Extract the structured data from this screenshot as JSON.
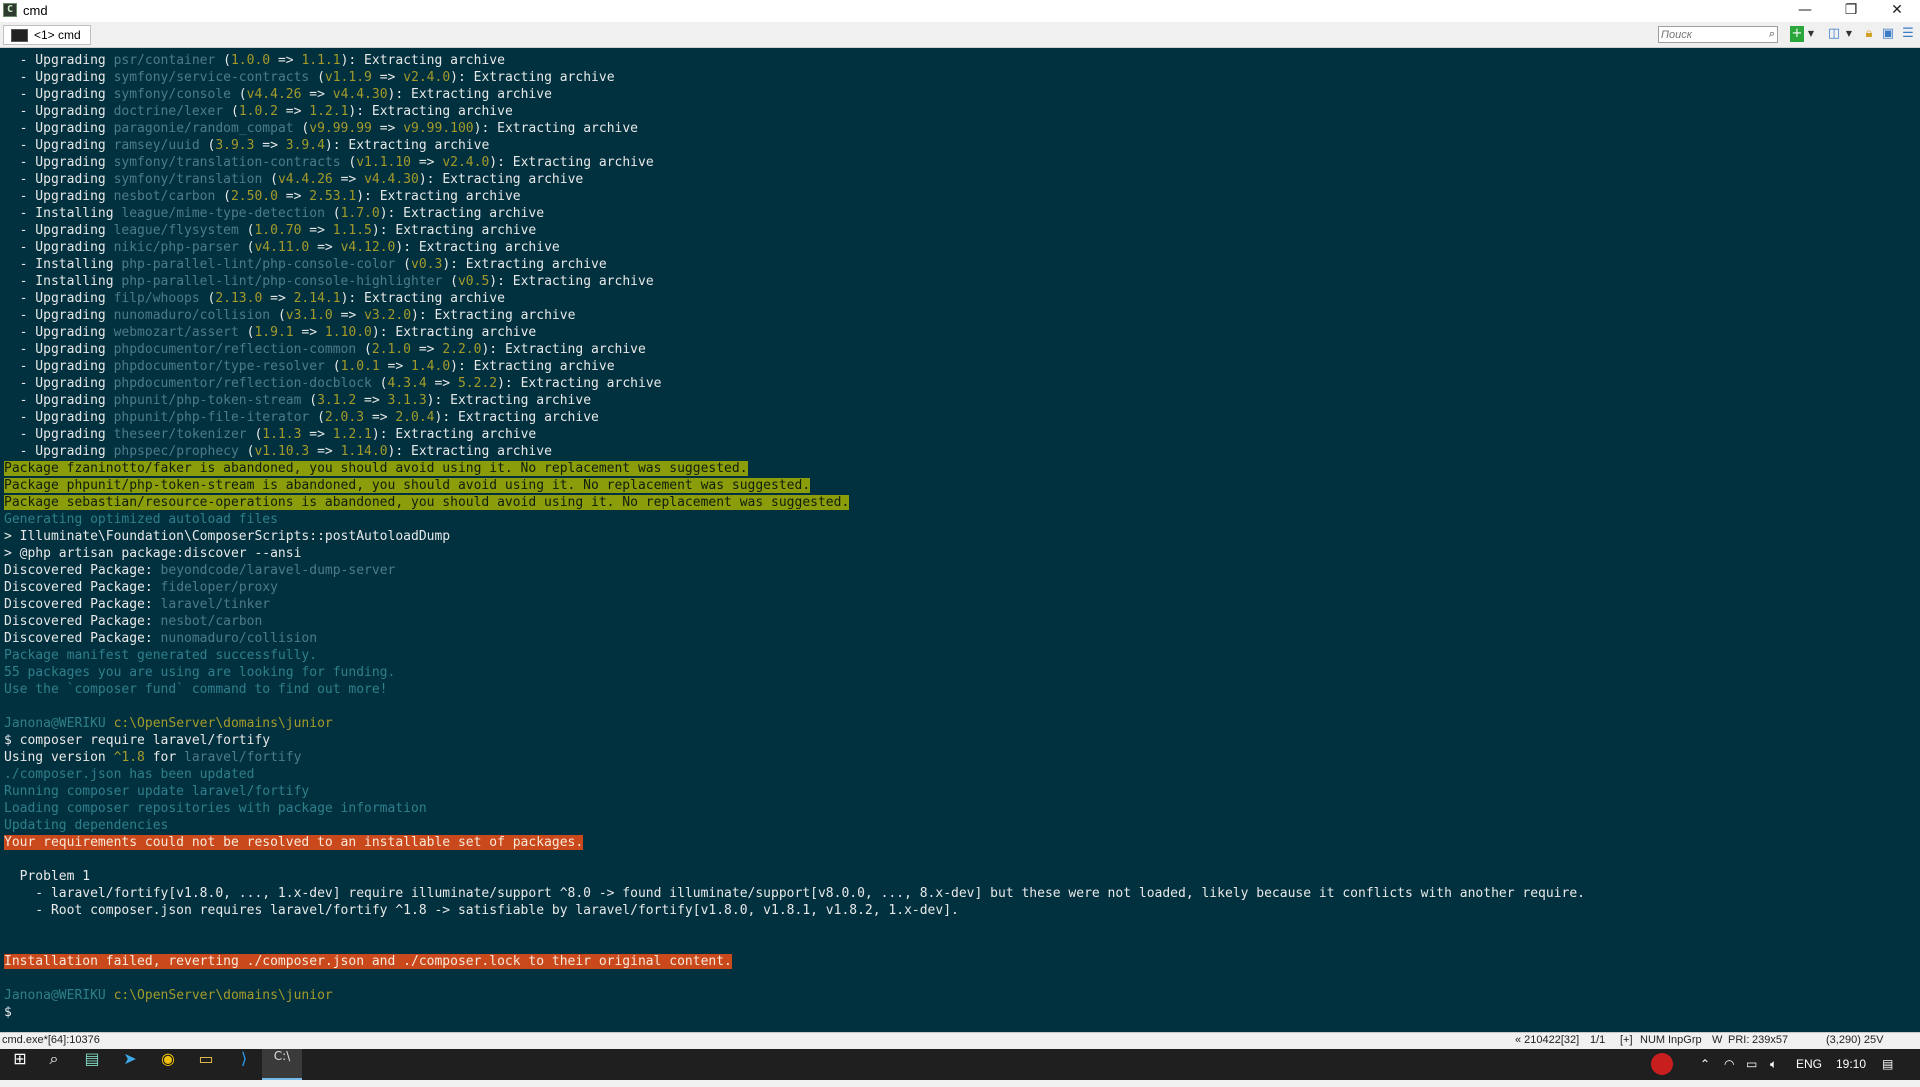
{
  "window": {
    "title": "cmd",
    "app_icon": "C",
    "minimize": "—",
    "restore": "❐",
    "close": "✕"
  },
  "tab": {
    "label": "<1> cmd"
  },
  "search": {
    "placeholder": "Поиск"
  },
  "toolbar_icons": [
    "add-console-icon",
    "dropdown-icon",
    "split-view-icon",
    "dropdown-icon",
    "lock-icon",
    "panel-icon",
    "menu-icon"
  ],
  "terminal": {
    "upgrades": [
      {
        "verb": "Upgrading",
        "pkg": "psr/container",
        "from": "1.0.0",
        "to": "1.1.1"
      },
      {
        "verb": "Upgrading",
        "pkg": "symfony/service-contracts",
        "from": "v1.1.9",
        "to": "v2.4.0"
      },
      {
        "verb": "Upgrading",
        "pkg": "symfony/console",
        "from": "v4.4.26",
        "to": "v4.4.30"
      },
      {
        "verb": "Upgrading",
        "pkg": "doctrine/lexer",
        "from": "1.0.2",
        "to": "1.2.1"
      },
      {
        "verb": "Upgrading",
        "pkg": "paragonie/random_compat",
        "from": "v9.99.99",
        "to": "v9.99.100"
      },
      {
        "verb": "Upgrading",
        "pkg": "ramsey/uuid",
        "from": "3.9.3",
        "to": "3.9.4"
      },
      {
        "verb": "Upgrading",
        "pkg": "symfony/translation-contracts",
        "from": "v1.1.10",
        "to": "v2.4.0"
      },
      {
        "verb": "Upgrading",
        "pkg": "symfony/translation",
        "from": "v4.4.26",
        "to": "v4.4.30"
      },
      {
        "verb": "Upgrading",
        "pkg": "nesbot/carbon",
        "from": "2.50.0",
        "to": "2.53.1"
      },
      {
        "verb": "Installing",
        "pkg": "league/mime-type-detection",
        "from": "",
        "to": "1.7.0"
      },
      {
        "verb": "Upgrading",
        "pkg": "league/flysystem",
        "from": "1.0.70",
        "to": "1.1.5"
      },
      {
        "verb": "Upgrading",
        "pkg": "nikic/php-parser",
        "from": "v4.11.0",
        "to": "v4.12.0"
      },
      {
        "verb": "Installing",
        "pkg": "php-parallel-lint/php-console-color",
        "from": "",
        "to": "v0.3"
      },
      {
        "verb": "Installing",
        "pkg": "php-parallel-lint/php-console-highlighter",
        "from": "",
        "to": "v0.5"
      },
      {
        "verb": "Upgrading",
        "pkg": "filp/whoops",
        "from": "2.13.0",
        "to": "2.14.1"
      },
      {
        "verb": "Upgrading",
        "pkg": "nunomaduro/collision",
        "from": "v3.1.0",
        "to": "v3.2.0"
      },
      {
        "verb": "Upgrading",
        "pkg": "webmozart/assert",
        "from": "1.9.1",
        "to": "1.10.0"
      },
      {
        "verb": "Upgrading",
        "pkg": "phpdocumentor/reflection-common",
        "from": "2.1.0",
        "to": "2.2.0"
      },
      {
        "verb": "Upgrading",
        "pkg": "phpdocumentor/type-resolver",
        "from": "1.0.1",
        "to": "1.4.0"
      },
      {
        "verb": "Upgrading",
        "pkg": "phpdocumentor/reflection-docblock",
        "from": "4.3.4",
        "to": "5.2.2"
      },
      {
        "verb": "Upgrading",
        "pkg": "phpunit/php-token-stream",
        "from": "3.1.2",
        "to": "3.1.3"
      },
      {
        "verb": "Upgrading",
        "pkg": "phpunit/php-file-iterator",
        "from": "2.0.3",
        "to": "2.0.4"
      },
      {
        "verb": "Upgrading",
        "pkg": "theseer/tokenizer",
        "from": "1.1.3",
        "to": "1.2.1"
      },
      {
        "verb": "Upgrading",
        "pkg": "phpspec/prophecy",
        "from": "v1.10.3",
        "to": "1.14.0"
      }
    ],
    "extract_suffix": "): Extracting archive",
    "arrow": " => ",
    "warnings": [
      "Package fzaninotto/faker is abandoned, you should avoid using it. No replacement was suggested.",
      "Package phpunit/php-token-stream is abandoned, you should avoid using it. No replacement was suggested.",
      "Package sebastian/resource-operations is abandoned, you should avoid using it. No replacement was suggested."
    ],
    "generating": "Generating optimized autoload files",
    "script1": "> Illuminate\\Foundation\\ComposerScripts::postAutoloadDump",
    "script2": "> @php artisan package:discover --ansi",
    "discovered_label": "Discovered Package: ",
    "discovered": [
      "beyondcode/laravel-dump-server",
      "fideloper/proxy",
      "laravel/tinker",
      "nesbot/carbon",
      "nunomaduro/collision"
    ],
    "manifest": "Package manifest generated successfully.",
    "funding": "55 packages you are using are looking for funding.",
    "fund_cmd": "Use the `composer fund` command to find out more!",
    "prompt_user": "Janona@WERIKU",
    "prompt_path": "c:\\OpenServer\\domains\\junior",
    "command": "$ composer require laravel/fortify",
    "using_prefix": "Using version ",
    "using_version": "^1.8",
    "using_for": " for ",
    "using_pkg": "laravel/fortify",
    "updated": "./composer.json has been updated",
    "running": "Running composer update laravel/fortify",
    "loading": "Loading composer repositories with package information",
    "updating": "Updating dependencies",
    "error1": "Your requirements could not be resolved to an installable set of packages.",
    "problem_title": "  Problem 1",
    "problem_l1": "    - laravel/fortify[v1.8.0, ..., 1.x-dev] require illuminate/support ^8.0 -> found illuminate/support[v8.0.0, ..., 8.x-dev] but these were not loaded, likely because it conflicts with another require.",
    "problem_l2": "    - Root composer.json requires laravel/fortify ^1.8 -> satisfiable by laravel/fortify[v1.8.0, v1.8.1, v1.8.2, 1.x-dev].",
    "error2": "Installation failed, reverting ./composer.json and ./composer.lock to their original content.",
    "final_prompt": "$ "
  },
  "statusbar": {
    "left": "cmd.exe*[64]:10376",
    "right": [
      "« 210422[32]",
      "1/1",
      "[+]",
      "NUM",
      "InpGrp",
      "W",
      "PRI:",
      "239x57",
      "(3,290) 25V"
    ]
  },
  "taskbar": {
    "items": [
      "windows-start-icon",
      "search-icon",
      "terminal-app-icon",
      "telegram-icon",
      "chrome-icon",
      "file-explorer-icon",
      "vscode-icon",
      "cmd-icon"
    ],
    "tray_lang": "ENG",
    "tray_time": "19:10"
  }
}
